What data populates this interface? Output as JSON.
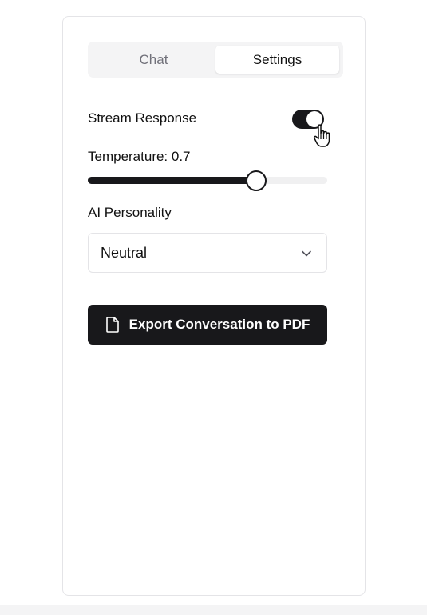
{
  "tabs": {
    "chat_label": "Chat",
    "settings_label": "Settings",
    "active": "Settings"
  },
  "settings": {
    "stream_response": {
      "label": "Stream Response",
      "enabled": true
    },
    "temperature": {
      "label": "Temperature: 0.7",
      "value": 0.7,
      "min": 0,
      "max": 1
    },
    "personality": {
      "label": "AI Personality",
      "selected": "Neutral"
    },
    "export": {
      "label": "Export Conversation to PDF",
      "icon": "file-icon"
    }
  },
  "colors": {
    "accent": "#18181b",
    "muted_text": "#71717a",
    "tab_bg": "#f4f4f5",
    "border": "#e4e4e7"
  }
}
